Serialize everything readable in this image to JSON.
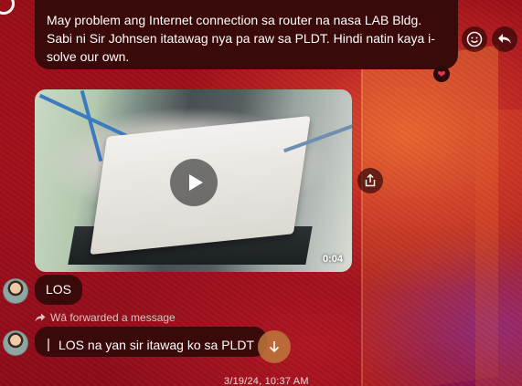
{
  "messages": [
    {
      "text": "May problem ang Internet connection sa router na nasa LAB Bldg. Sabi ni Sir Johnsen itatawag nya pa raw sa PLDT. Hindi natin kaya i-solve our own.",
      "reaction": "❤"
    },
    {
      "video_duration": "0:04"
    },
    {
      "text": "LOS"
    },
    {
      "forward_label": "Wā forwarded a message",
      "text": "LOS na yan sir itawag ko sa PLDT"
    }
  ],
  "timestamp": "3/19/24, 10:37 AM",
  "icons": {
    "react": "smile-icon",
    "reply": "reply-icon",
    "share": "share-icon",
    "forward": "forward-arrow-icon",
    "scroll_down": "arrow-down-icon",
    "play": "play-icon",
    "reaction": "heart-icon"
  },
  "colors": {
    "bubble_bg": "#3a0909",
    "accent_heart": "#e5344a",
    "scroll_button": "#be783c"
  }
}
